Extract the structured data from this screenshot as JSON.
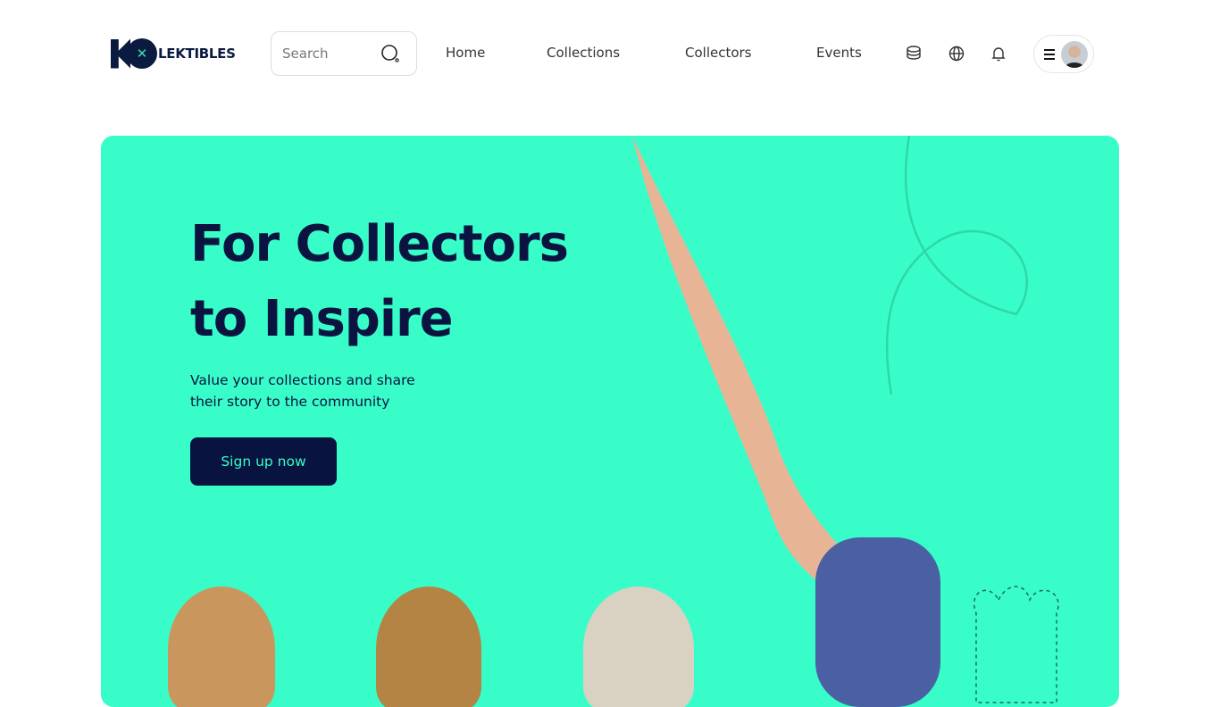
{
  "brand": {
    "logo_text": "LEKTIBLES",
    "logo_mark": "KO"
  },
  "search": {
    "placeholder": "Search"
  },
  "nav": [
    {
      "label": "Home"
    },
    {
      "label": "Collections"
    },
    {
      "label": "Collectors"
    },
    {
      "label": "Events"
    }
  ],
  "hero": {
    "title_line1": "For Collectors",
    "title_line2": "to Inspire",
    "subtitle_line1": "Value your collections and share",
    "subtitle_line2": "their story to the community",
    "cta": "Sign up now"
  },
  "colors": {
    "accent": "#38fdc9",
    "navy": "#08133f"
  }
}
